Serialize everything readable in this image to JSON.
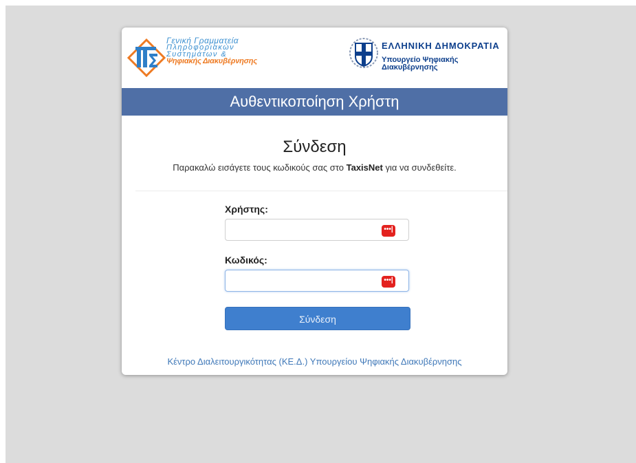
{
  "header": {
    "gsis_lines": [
      "Γενική Γραμματεία",
      "Πληροφοριακών",
      "Συστημάτων &",
      "Ψηφιακής Διακυβέρνησης"
    ],
    "gov_title": "ΕΛΛΗΝΙΚΗ ΔΗΜΟΚΡΑΤΙΑ",
    "gov_sub_1": "Υπουργείο Ψηφιακής",
    "gov_sub_2": "Διακυβέρνησης"
  },
  "banner": {
    "title": "Αυθεντικοποίηση Χρήστη"
  },
  "login": {
    "title": "Σύνδεση",
    "instructions_before": "Παρακαλώ εισάγετε τους κωδικούς σας στο ",
    "instructions_bold": "TaxisNet",
    "instructions_after": " για να συνδεθείτε.",
    "username_label": "Χρήστης:",
    "username_value": "",
    "password_label": "Κωδικός:",
    "password_value": "",
    "password_manager_icon": "password-manager-icon",
    "submit_label": "Σύνδεση"
  },
  "footer": {
    "link_text": "Κέντρο Διαλειτουργικότητας (ΚΕ.Δ.) Υπουργείου Ψηφιακής Διακυβέρνησης"
  },
  "colors": {
    "banner": "#4f6fa6",
    "button": "#3f7fce",
    "link": "#3f78b8",
    "gsis_blue": "#3a8fd0",
    "gsis_orange": "#ee7a22",
    "gov_blue": "#0d3f8c",
    "password_icon": "#e3221f"
  }
}
